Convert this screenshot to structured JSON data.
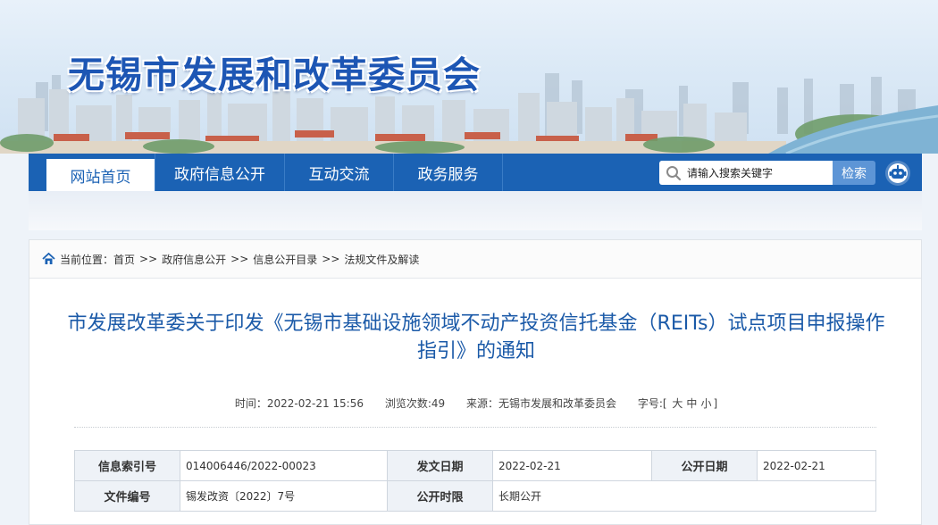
{
  "site": {
    "title": "无锡市发展和改革委员会"
  },
  "nav": {
    "items": [
      {
        "label": "网站首页",
        "active": true
      },
      {
        "label": "政府信息公开"
      },
      {
        "label": "互动交流"
      },
      {
        "label": "政务服务"
      }
    ],
    "search_placeholder": "请输入搜索关键字",
    "search_button": "检索",
    "icons": [
      "search-icon",
      "robot-icon"
    ]
  },
  "breadcrumb": {
    "prefix": "当前位置：",
    "items": [
      "首页",
      "政府信息公开",
      "信息公开目录",
      "法规文件及解读"
    ],
    "separator": ">>"
  },
  "article": {
    "title": "市发展改革委关于印发《无锡市基础设施领域不动产投资信托基金（REITs）试点项目申报操作指引》的通知",
    "meta": {
      "time_label": "时间：",
      "time": "2022-02-21 15:56",
      "views_label": "浏览次数:",
      "views": "49",
      "source_label": "来源：",
      "source": "无锡市发展和改革委员会",
      "font_label": "字号:",
      "font_open": "[",
      "font_sizes": [
        "大",
        "中",
        "小"
      ],
      "font_close": "]"
    }
  },
  "info_table": {
    "row1": {
      "index_label": "信息索引号",
      "index_value": "014006446/2022-00023",
      "issue_label": "发文日期",
      "issue_value": "2022-02-21",
      "public_label": "公开日期",
      "public_value": "2022-02-21"
    },
    "row2": {
      "docno_label": "文件编号",
      "docno_value": "锡发改资〔2022〕7号",
      "period_label": "公开时限",
      "period_value": "长期公开"
    }
  },
  "colors": {
    "nav_blue": "#1b62b4",
    "title_blue": "#1b5aa8",
    "search_button": "#5d95d6"
  }
}
